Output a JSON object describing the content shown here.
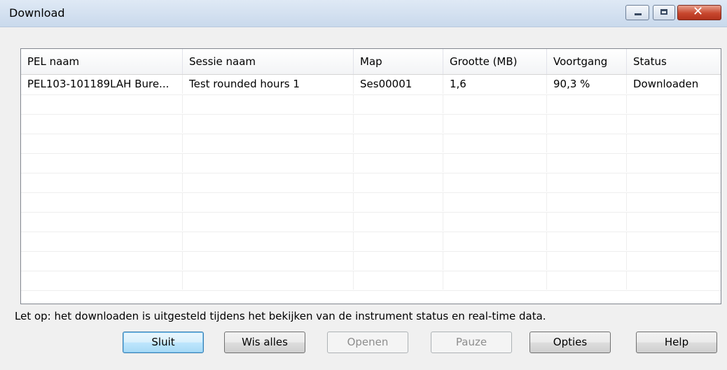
{
  "window": {
    "title": "Download"
  },
  "table": {
    "columns": [
      "PEL naam",
      "Sessie naam",
      "Map",
      "Grootte (MB)",
      "Voortgang",
      "Status"
    ],
    "rows": [
      [
        "PEL103-101189LAH Bure...",
        "Test rounded hours 1",
        "Ses00001",
        "1,6",
        "90,3 %",
        "Downloaden"
      ]
    ]
  },
  "note": "Let op: het downloaden is uitgesteld tijdens het bekijken van de instrument status en real-time data.",
  "buttons": {
    "close": "Sluit",
    "clear_all": "Wis alles",
    "open": "Openen",
    "pause": "Pauze",
    "options": "Opties",
    "help": "Help"
  }
}
